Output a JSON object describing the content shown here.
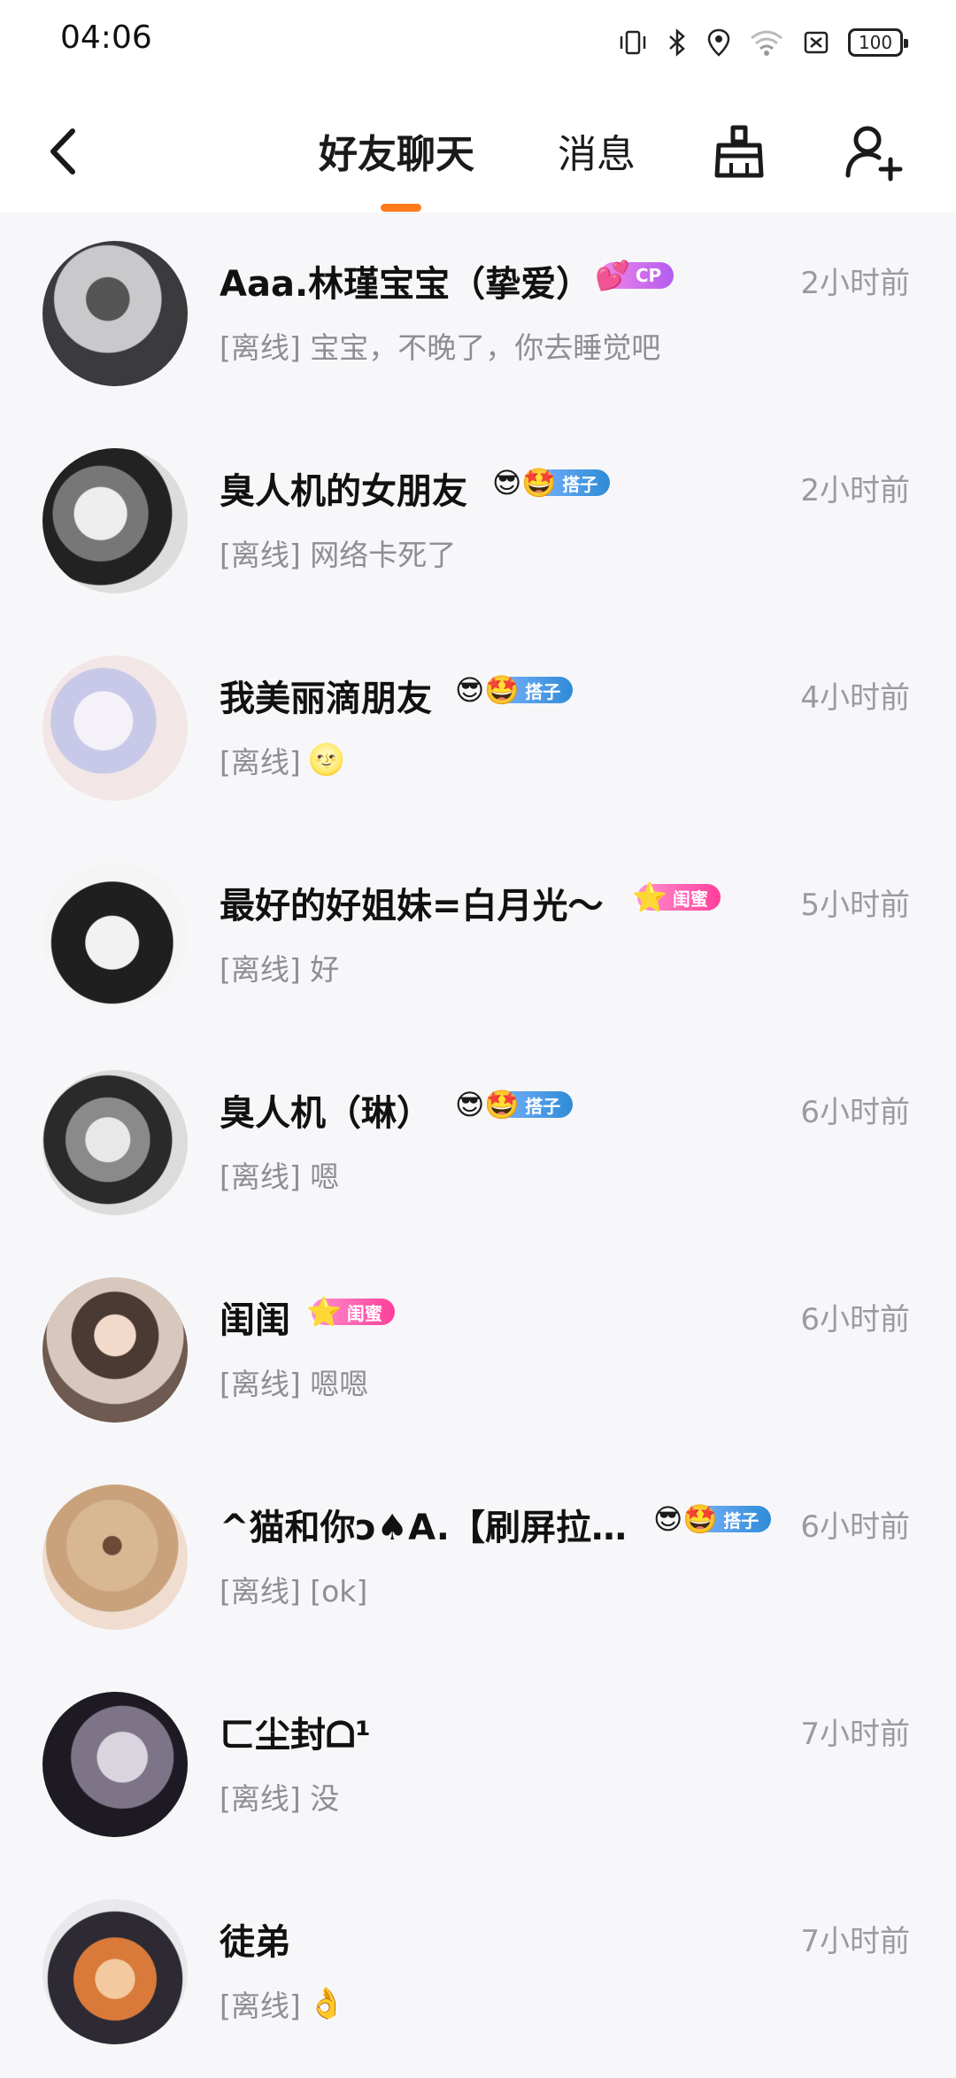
{
  "status_bar": {
    "time": "04:06",
    "battery": "100"
  },
  "header": {
    "tabs": [
      {
        "label": "好友聊天",
        "active": true
      },
      {
        "label": "消息",
        "active": false
      }
    ],
    "accent": "#ff7a1a"
  },
  "chats": [
    {
      "name": "Aaa.林瑾宝宝（挚爱）",
      "badge": "CP",
      "badge_emoji": "💕",
      "preview": "[离线] 宝宝，不晚了，你去睡觉吧",
      "preview_emoji": "",
      "time": "2小时前"
    },
    {
      "name": "臭人机的女朋友",
      "badge": "搭子",
      "badge_emoji": "😎🤩",
      "preview": "[离线] 网络卡死了",
      "preview_emoji": "",
      "time": "2小时前"
    },
    {
      "name": "我美丽滴朋友",
      "badge": "搭子",
      "badge_emoji": "😎🤩",
      "preview": "[离线]",
      "preview_emoji": "🌝",
      "time": "4小时前"
    },
    {
      "name": "最好的好姐妹=白月光～",
      "badge": "闺蜜",
      "badge_emoji": "⭐",
      "preview": "[离线] 好",
      "preview_emoji": "",
      "time": "5小时前"
    },
    {
      "name": "臭人机（琳）",
      "badge": "搭子",
      "badge_emoji": "😎🤩",
      "preview": "[离线] 嗯",
      "preview_emoji": "",
      "time": "6小时前"
    },
    {
      "name": "闺闺",
      "badge": "闺蜜",
      "badge_emoji": "⭐",
      "preview": "[离线] 嗯嗯",
      "preview_emoji": "",
      "time": "6小时前"
    },
    {
      "name": "^猫和你ɔ♠A.【刷屏拉…",
      "badge": "搭子",
      "badge_emoji": "😎🤩",
      "preview": "[离线] [ok]",
      "preview_emoji": "",
      "time": "6小时前"
    },
    {
      "name": "ㄈ尘封ᗝ¹",
      "badge": "",
      "badge_emoji": "",
      "preview": "[离线] 没",
      "preview_emoji": "",
      "time": "7小时前"
    },
    {
      "name": "徒弟",
      "badge": "",
      "badge_emoji": "",
      "preview": "[离线]",
      "preview_emoji": "👌",
      "time": "7小时前"
    }
  ]
}
